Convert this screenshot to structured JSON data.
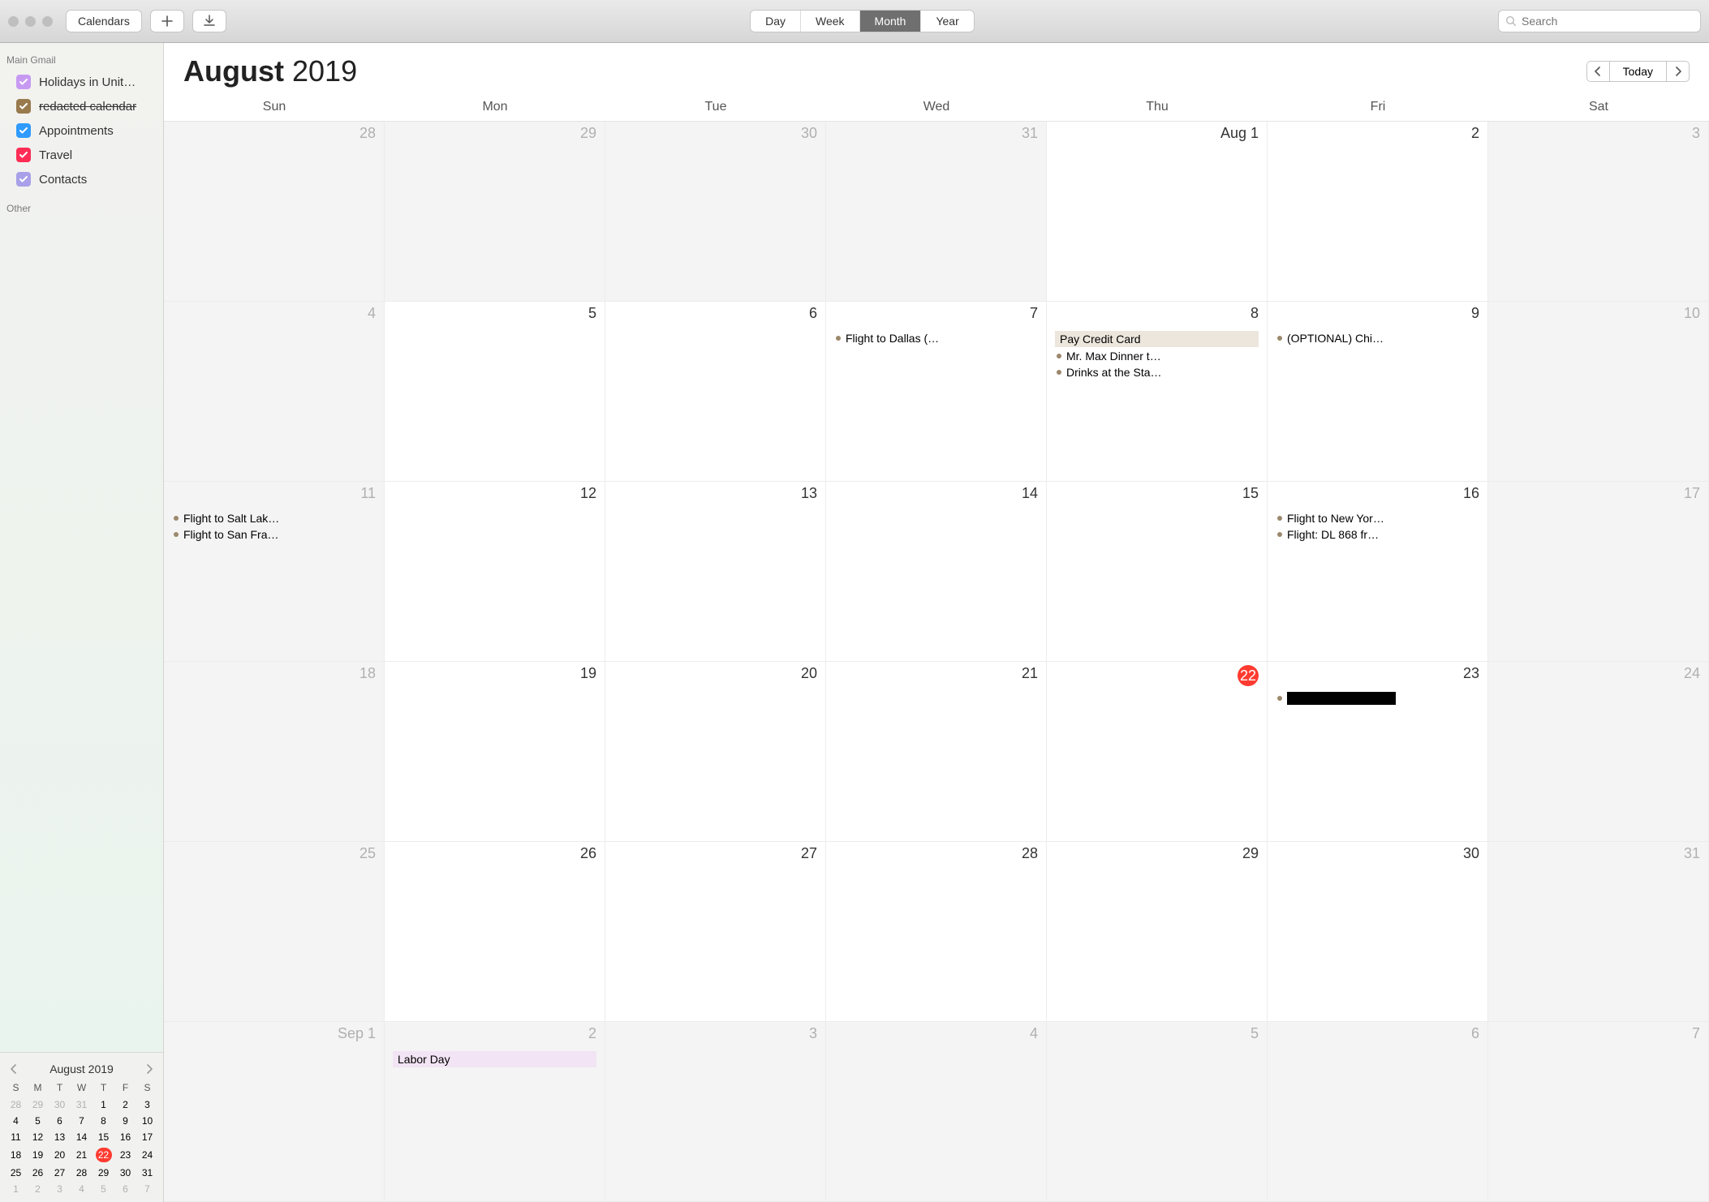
{
  "toolbar": {
    "calendars_label": "Calendars",
    "view": {
      "day": "Day",
      "week": "Week",
      "month": "Month",
      "year": "Year",
      "active": "month"
    },
    "today_label": "Today",
    "search_placeholder": "Search"
  },
  "sidebar": {
    "sections": [
      {
        "title": "Main Gmail",
        "cals": [
          {
            "label": "Holidays in Unit…",
            "color": "#c79af2",
            "checked": true
          },
          {
            "label": "redacted calendar",
            "color": "#997a4d",
            "checked": true,
            "strike": true
          },
          {
            "label": "Appointments",
            "color": "#2f9bff",
            "checked": true
          },
          {
            "label": "Travel",
            "color": "#ff2d55",
            "checked": true
          },
          {
            "label": "Contacts",
            "color": "#a8a0e8",
            "checked": true
          }
        ]
      },
      {
        "title": "Other",
        "cals": []
      }
    ]
  },
  "header": {
    "month": "August",
    "year": "2019"
  },
  "weekdays": [
    "Sun",
    "Mon",
    "Tue",
    "Wed",
    "Thu",
    "Fri",
    "Sat"
  ],
  "today_date": "22",
  "weeks": [
    [
      {
        "label": "28",
        "out": true
      },
      {
        "label": "29",
        "out": true
      },
      {
        "label": "30",
        "out": true
      },
      {
        "label": "31",
        "out": true
      },
      {
        "label": "Aug 1"
      },
      {
        "label": "2"
      },
      {
        "label": "3",
        "out": true
      }
    ],
    [
      {
        "label": "4",
        "out": true
      },
      {
        "label": "5"
      },
      {
        "label": "6"
      },
      {
        "label": "7",
        "events": [
          {
            "text": "Flight to Dallas (…"
          }
        ]
      },
      {
        "label": "8",
        "events": [
          {
            "text": "Pay Credit Card",
            "style": "bar"
          },
          {
            "text": "Mr. Max Dinner t…"
          },
          {
            "text": "Drinks at the Sta…"
          }
        ]
      },
      {
        "label": "9",
        "events": [
          {
            "text": "(OPTIONAL) Chi…"
          }
        ]
      },
      {
        "label": "10",
        "out": true
      }
    ],
    [
      {
        "label": "11",
        "out": true,
        "events": [
          {
            "text": "Flight to Salt Lak…"
          },
          {
            "text": "Flight to San Fra…"
          }
        ]
      },
      {
        "label": "12"
      },
      {
        "label": "13"
      },
      {
        "label": "14"
      },
      {
        "label": "15"
      },
      {
        "label": "16",
        "events": [
          {
            "text": "Flight to New Yor…"
          },
          {
            "text": "Flight: DL 868 fr…"
          }
        ]
      },
      {
        "label": "17",
        "out": true
      }
    ],
    [
      {
        "label": "18",
        "out": true
      },
      {
        "label": "19"
      },
      {
        "label": "20"
      },
      {
        "label": "21"
      },
      {
        "label": "22",
        "today": true
      },
      {
        "label": "23",
        "events": [
          {
            "text": "redacted event and…",
            "redact": true
          }
        ]
      },
      {
        "label": "24",
        "out": true
      }
    ],
    [
      {
        "label": "25",
        "out": true
      },
      {
        "label": "26"
      },
      {
        "label": "27"
      },
      {
        "label": "28"
      },
      {
        "label": "29"
      },
      {
        "label": "30"
      },
      {
        "label": "31",
        "out": true
      }
    ],
    [
      {
        "label": "Sep 1",
        "out": true
      },
      {
        "label": "2",
        "out": true,
        "events": [
          {
            "text": "Labor Day",
            "style": "holiday"
          }
        ]
      },
      {
        "label": "3",
        "out": true
      },
      {
        "label": "4",
        "out": true
      },
      {
        "label": "5",
        "out": true
      },
      {
        "label": "6",
        "out": true
      },
      {
        "label": "7",
        "out": true
      }
    ]
  ],
  "mini": {
    "title": "August 2019",
    "headers": [
      "S",
      "M",
      "T",
      "W",
      "T",
      "F",
      "S"
    ],
    "rows": [
      [
        {
          "n": "28",
          "dim": true
        },
        {
          "n": "29",
          "dim": true
        },
        {
          "n": "30",
          "dim": true
        },
        {
          "n": "31",
          "dim": true
        },
        {
          "n": "1"
        },
        {
          "n": "2"
        },
        {
          "n": "3"
        }
      ],
      [
        {
          "n": "4"
        },
        {
          "n": "5"
        },
        {
          "n": "6"
        },
        {
          "n": "7"
        },
        {
          "n": "8"
        },
        {
          "n": "9"
        },
        {
          "n": "10"
        }
      ],
      [
        {
          "n": "11"
        },
        {
          "n": "12"
        },
        {
          "n": "13"
        },
        {
          "n": "14"
        },
        {
          "n": "15"
        },
        {
          "n": "16"
        },
        {
          "n": "17"
        }
      ],
      [
        {
          "n": "18"
        },
        {
          "n": "19"
        },
        {
          "n": "20"
        },
        {
          "n": "21"
        },
        {
          "n": "22",
          "today": true
        },
        {
          "n": "23"
        },
        {
          "n": "24"
        }
      ],
      [
        {
          "n": "25"
        },
        {
          "n": "26"
        },
        {
          "n": "27"
        },
        {
          "n": "28"
        },
        {
          "n": "29"
        },
        {
          "n": "30"
        },
        {
          "n": "31"
        }
      ],
      [
        {
          "n": "1",
          "dim": true
        },
        {
          "n": "2",
          "dim": true
        },
        {
          "n": "3",
          "dim": true
        },
        {
          "n": "4",
          "dim": true
        },
        {
          "n": "5",
          "dim": true
        },
        {
          "n": "6",
          "dim": true
        },
        {
          "n": "7",
          "dim": true
        }
      ]
    ]
  }
}
